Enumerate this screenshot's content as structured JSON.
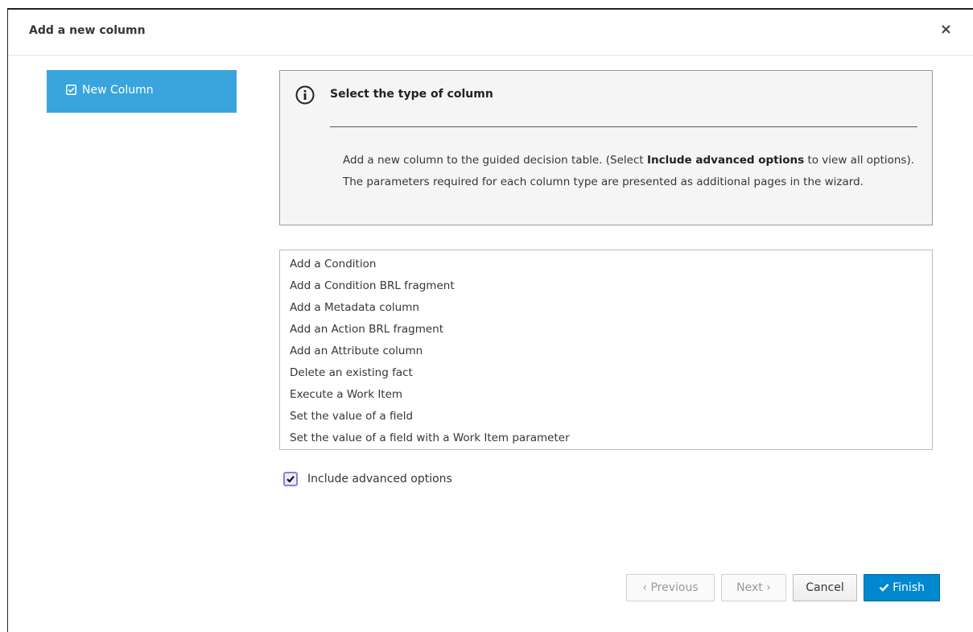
{
  "dialog": {
    "title": "Add a new column",
    "close_label": "×"
  },
  "sidebar": {
    "items": [
      {
        "label": "New Column",
        "icon": "checkbox-checked-icon",
        "active": true
      }
    ]
  },
  "info": {
    "icon": "info-circle-icon",
    "title": "Select the type of column",
    "text_before": "Add a new column to the guided decision table. (Select ",
    "text_bold": "Include advanced options",
    "text_after": " to view all options). The parameters required for each column type are presented as additional pages in the wizard."
  },
  "column_types": [
    "Add a Condition",
    "Add a Condition BRL fragment",
    "Add a Metadata column",
    "Add an Action BRL fragment",
    "Add an Attribute column",
    "Delete an existing fact",
    "Execute a Work Item",
    "Set the value of a field",
    "Set the value of a field with a Work Item parameter"
  ],
  "advanced": {
    "label": "Include advanced options",
    "checked": true
  },
  "buttons": {
    "previous": "‹ Previous",
    "next": "Next ›",
    "cancel": "Cancel",
    "finish": "Finish"
  },
  "colors": {
    "sidebar_active": "#39a5dc",
    "finish": "#0088ce"
  }
}
